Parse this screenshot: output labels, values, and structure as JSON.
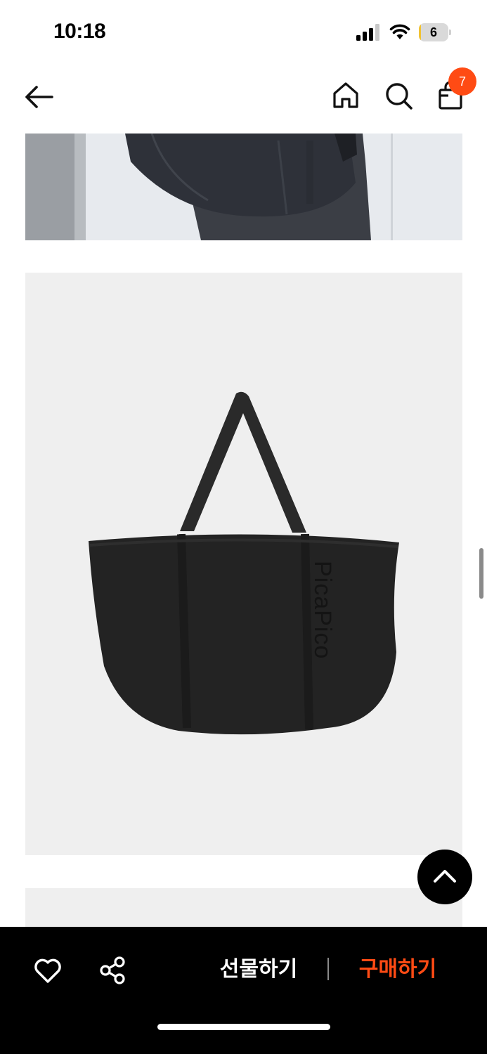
{
  "status_bar": {
    "time": "10:18",
    "battery_level": "6",
    "battery_fraction": 0.06,
    "icons": [
      "signal-icon",
      "wifi-icon",
      "battery-icon"
    ]
  },
  "nav": {
    "icons": [
      "back-arrow-icon",
      "home-icon",
      "search-icon",
      "shopping-bag-icon"
    ],
    "cart_badge_count": "7",
    "badge_color": "#ff4b14"
  },
  "product_images": {
    "brand_print": "PicaPico",
    "bag_color": "#202020",
    "background_color": "#efefef"
  },
  "floating": {
    "icons": [
      "chevron-up-icon"
    ]
  },
  "bottom_bar": {
    "gift_label": "선물하기",
    "buy_label": "구매하기",
    "buy_color": "#ff4b14",
    "icons": [
      "heart-icon",
      "share-icon"
    ]
  }
}
